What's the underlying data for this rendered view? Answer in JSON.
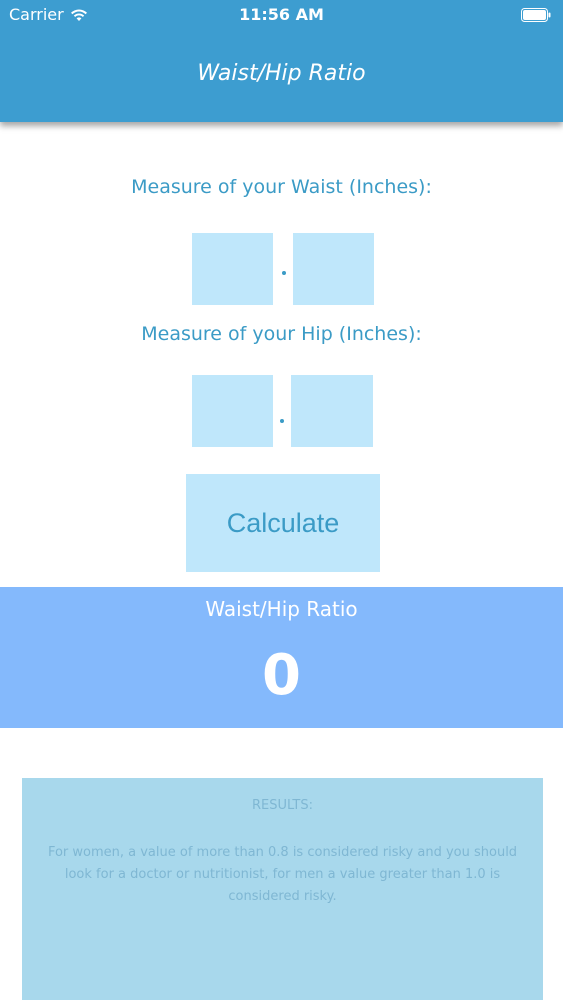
{
  "status_bar": {
    "carrier": "Carrier",
    "time": "11:56 AM"
  },
  "nav": {
    "title": "Waist/Hip Ratio"
  },
  "form": {
    "waist_label": "Measure of your Waist (Inches):",
    "hip_label": "Measure of your Hip (Inches):",
    "waist_int_value": "",
    "waist_dec_value": "",
    "hip_int_value": "",
    "hip_dec_value": "",
    "separator": ".",
    "calculate_label": "Calculate"
  },
  "result": {
    "title": "Waist/Hip Ratio",
    "value": "0"
  },
  "info": {
    "heading": "RESULTS:",
    "text": "For women, a value of more than 0.8 is considered risky and you should look for a doctor or nutritionist, for men a value greater than 1.0 is considered risky."
  },
  "colors": {
    "header": "#3d9dd0",
    "accent_text": "#3b9bc6",
    "input_bg": "#bfe7fb",
    "result_band": "#84b9fc",
    "info_panel": "#a8d8ec"
  },
  "icons": {
    "wifi": "wifi-icon",
    "battery": "battery-icon"
  }
}
